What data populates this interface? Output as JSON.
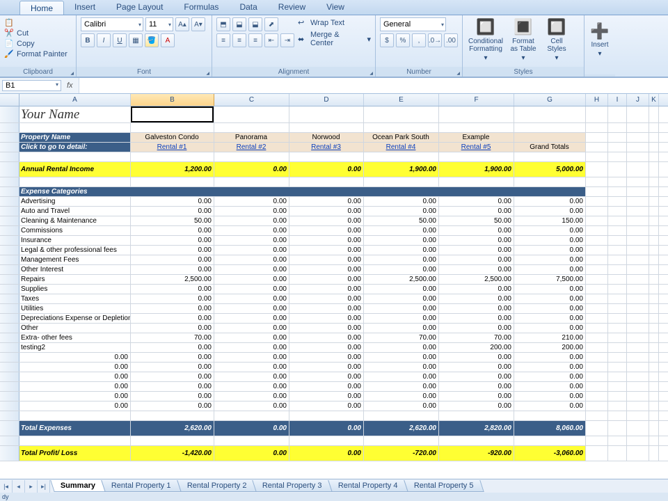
{
  "ribbon_tabs": [
    "Home",
    "Insert",
    "Page Layout",
    "Formulas",
    "Data",
    "Review",
    "View"
  ],
  "active_tab": "Home",
  "clipboard": {
    "cut": "Cut",
    "copy": "Copy",
    "painter": "Format Painter",
    "group": "Clipboard"
  },
  "font": {
    "name": "Calibri",
    "size": "11",
    "group": "Font"
  },
  "alignment": {
    "wrap": "Wrap Text",
    "merge": "Merge & Center",
    "group": "Alignment"
  },
  "number": {
    "format": "General",
    "group": "Number"
  },
  "styles": {
    "cond": "Conditional Formatting",
    "table": "Format as Table",
    "cell": "Cell Styles",
    "group": "Styles"
  },
  "cells": {
    "insert": "Insert"
  },
  "name_box": "B1",
  "columns": [
    "A",
    "B",
    "C",
    "D",
    "E",
    "F",
    "G",
    "H",
    "I",
    "J",
    "K"
  ],
  "r1": {
    "title": "Your Name"
  },
  "r_prop": {
    "label": "Property Name",
    "vals": [
      "Galveston Condo",
      "Panorama",
      "Norwood",
      "Ocean Park South",
      "Example",
      ""
    ]
  },
  "r_links": {
    "label": "Click to go to detail:",
    "vals": [
      "Rental #1",
      "Rental #2",
      "Rental #3",
      "Rental #4",
      "Rental #5"
    ],
    "total": "Grand Totals"
  },
  "r_income": {
    "label": "Annual Rental Income",
    "vals": [
      "1,200.00",
      "0.00",
      "0.00",
      "1,900.00",
      "1,900.00",
      "5,000.00"
    ]
  },
  "r_exphdr": "Expense Categories",
  "exp_rows": [
    {
      "l": "Advertising",
      "v": [
        "0.00",
        "0.00",
        "0.00",
        "0.00",
        "0.00",
        "0.00"
      ]
    },
    {
      "l": "Auto and Travel",
      "v": [
        "0.00",
        "0.00",
        "0.00",
        "0.00",
        "0.00",
        "0.00"
      ]
    },
    {
      "l": "Cleaning & Maintenance",
      "v": [
        "50.00",
        "0.00",
        "0.00",
        "50.00",
        "50.00",
        "150.00"
      ]
    },
    {
      "l": "Commissions",
      "v": [
        "0.00",
        "0.00",
        "0.00",
        "0.00",
        "0.00",
        "0.00"
      ]
    },
    {
      "l": "Insurance",
      "v": [
        "0.00",
        "0.00",
        "0.00",
        "0.00",
        "0.00",
        "0.00"
      ]
    },
    {
      "l": "Legal & other professional fees",
      "v": [
        "0.00",
        "0.00",
        "0.00",
        "0.00",
        "0.00",
        "0.00"
      ]
    },
    {
      "l": "Management Fees",
      "v": [
        "0.00",
        "0.00",
        "0.00",
        "0.00",
        "0.00",
        "0.00"
      ]
    },
    {
      "l": "Other Interest",
      "v": [
        "0.00",
        "0.00",
        "0.00",
        "0.00",
        "0.00",
        "0.00"
      ]
    },
    {
      "l": "Repairs",
      "v": [
        "2,500.00",
        "0.00",
        "0.00",
        "2,500.00",
        "2,500.00",
        "7,500.00"
      ]
    },
    {
      "l": "Supplies",
      "v": [
        "0.00",
        "0.00",
        "0.00",
        "0.00",
        "0.00",
        "0.00"
      ]
    },
    {
      "l": "Taxes",
      "v": [
        "0.00",
        "0.00",
        "0.00",
        "0.00",
        "0.00",
        "0.00"
      ]
    },
    {
      "l": "Utilities",
      "v": [
        "0.00",
        "0.00",
        "0.00",
        "0.00",
        "0.00",
        "0.00"
      ]
    },
    {
      "l": "Depreciations Expense or Depletion",
      "v": [
        "0.00",
        "0.00",
        "0.00",
        "0.00",
        "0.00",
        "0.00"
      ]
    },
    {
      "l": "Other",
      "v": [
        "0.00",
        "0.00",
        "0.00",
        "0.00",
        "0.00",
        "0.00"
      ]
    },
    {
      "l": "Extra- other fees",
      "v": [
        "70.00",
        "0.00",
        "0.00",
        "70.00",
        "70.00",
        "210.00"
      ]
    },
    {
      "l": "testing2",
      "v": [
        "0.00",
        "0.00",
        "0.00",
        "0.00",
        "200.00",
        "200.00"
      ]
    }
  ],
  "empty_rows": [
    [
      "0.00",
      "0.00",
      "0.00",
      "0.00",
      "0.00",
      "0.00",
      "0.00"
    ],
    [
      "0.00",
      "0.00",
      "0.00",
      "0.00",
      "0.00",
      "0.00",
      "0.00"
    ],
    [
      "0.00",
      "0.00",
      "0.00",
      "0.00",
      "0.00",
      "0.00",
      "0.00"
    ],
    [
      "0.00",
      "0.00",
      "0.00",
      "0.00",
      "0.00",
      "0.00",
      "0.00"
    ],
    [
      "0.00",
      "0.00",
      "0.00",
      "0.00",
      "0.00",
      "0.00",
      "0.00"
    ],
    [
      "0.00",
      "0.00",
      "0.00",
      "0.00",
      "0.00",
      "0.00",
      "0.00"
    ]
  ],
  "r_totexp": {
    "label": "Total Expenses",
    "vals": [
      "2,620.00",
      "0.00",
      "0.00",
      "2,620.00",
      "2,820.00",
      "8,060.00"
    ]
  },
  "r_profit": {
    "label": "Total Profit/ Loss",
    "vals": [
      "-1,420.00",
      "0.00",
      "0.00",
      "-720.00",
      "-920.00",
      "-3,060.00"
    ]
  },
  "sheet_tabs": [
    "Summary",
    "Rental Property 1",
    "Rental Property 2",
    "Rental Property 3",
    "Rental Property 4",
    "Rental Property 5"
  ],
  "active_sheet": "Summary",
  "status": "dy"
}
